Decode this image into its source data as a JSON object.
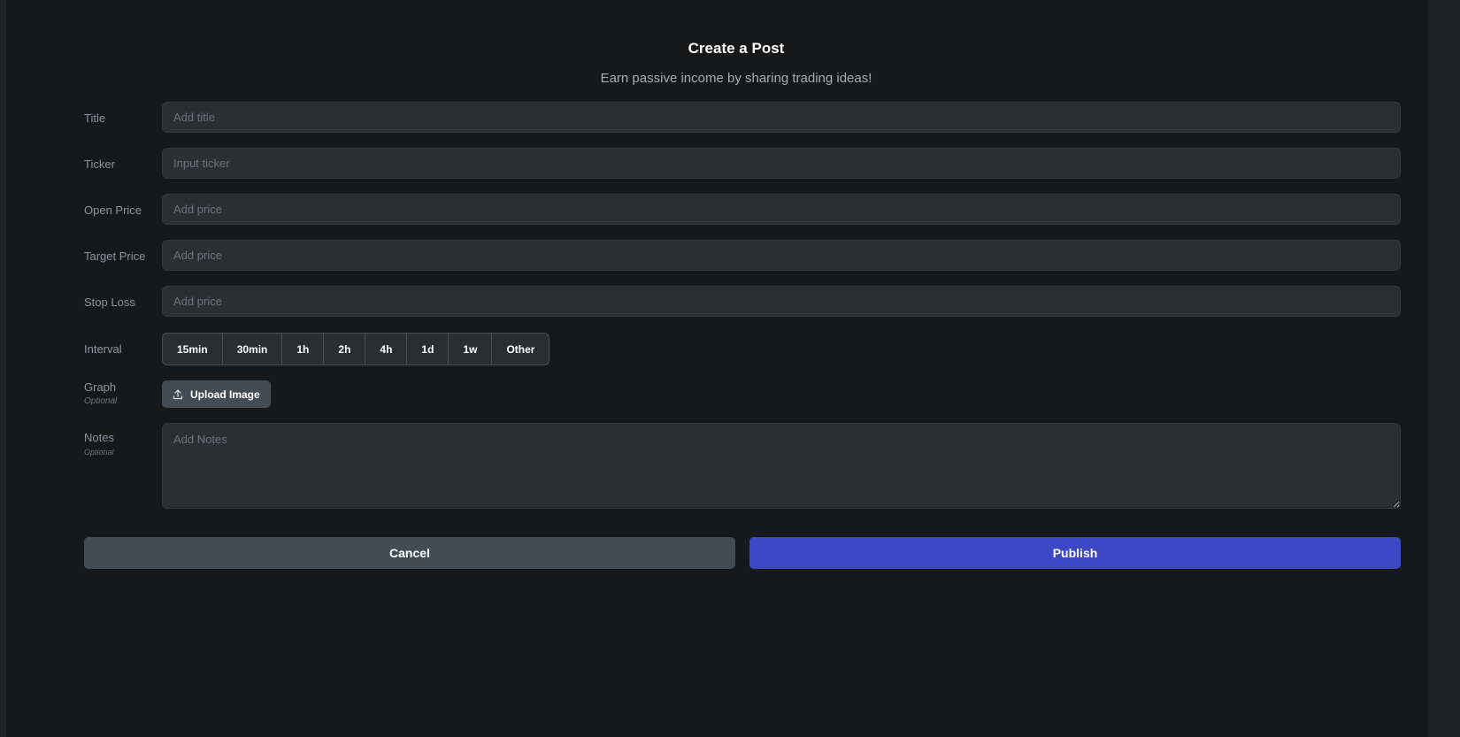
{
  "header": {
    "title": "Create a Post",
    "subtitle": "Earn passive income by sharing trading ideas!"
  },
  "form": {
    "title": {
      "label": "Title",
      "placeholder": "Add title",
      "value": ""
    },
    "ticker": {
      "label": "Ticker",
      "placeholder": "Input ticker",
      "value": ""
    },
    "open_price": {
      "label": "Open Price",
      "placeholder": "Add price",
      "value": ""
    },
    "target_price": {
      "label": "Target Price",
      "placeholder": "Add price",
      "value": ""
    },
    "stop_loss": {
      "label": "Stop Loss",
      "placeholder": "Add price",
      "value": ""
    },
    "interval": {
      "label": "Interval",
      "options": [
        "15min",
        "30min",
        "1h",
        "2h",
        "4h",
        "1d",
        "1w",
        "Other"
      ]
    },
    "graph": {
      "label": "Graph",
      "optional": "Optional",
      "upload_label": "Upload Image",
      "icon": "upload-icon"
    },
    "notes": {
      "label": "Notes",
      "optional": "Optional",
      "placeholder": "Add Notes",
      "value": ""
    }
  },
  "actions": {
    "cancel_label": "Cancel",
    "publish_label": "Publish"
  },
  "colors": {
    "background": "#17181a",
    "field": "#2c2f32",
    "publish": "#3e47c5",
    "cancel": "#434c55"
  }
}
